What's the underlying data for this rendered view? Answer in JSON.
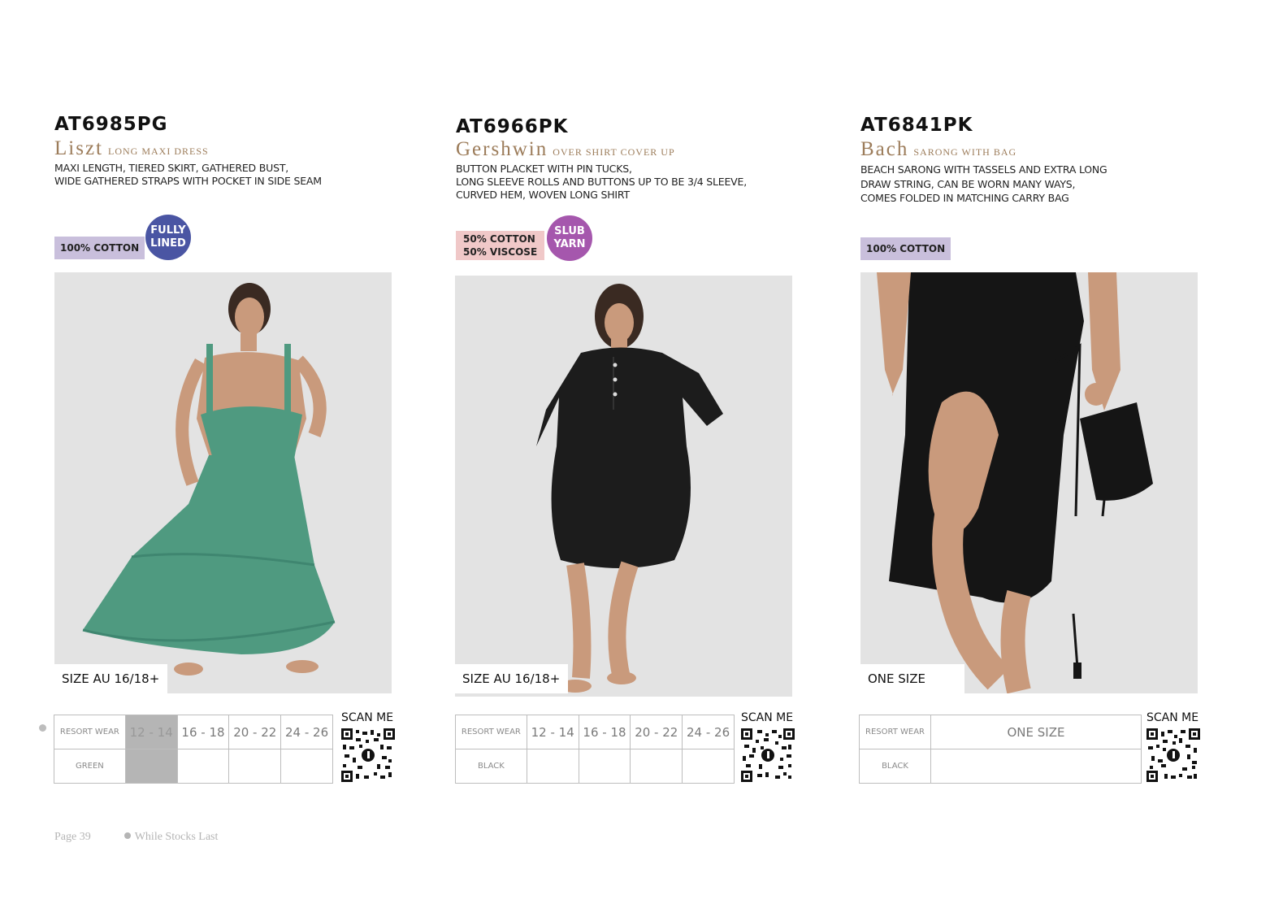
{
  "products": [
    {
      "code": "AT6985PG",
      "name": "Liszt",
      "type": "LONG MAXI DRESS",
      "desc": [
        "MAXI LENGTH, TIERED SKIRT, GATHERED BUST,",
        "WIDE GATHERED STRAPS WITH POCKET IN SIDE SEAM"
      ],
      "fabric": [
        "100% COTTON"
      ],
      "fabric_color": "#c9bfdc",
      "badge": [
        "FULLY",
        "LINED"
      ],
      "badge_color": "#4a55a3",
      "size_label": "SIZE AU 16/18+",
      "table": {
        "row1": "RESORT WEAR",
        "sizes": [
          "12 - 14",
          "16 - 18",
          "20 - 22",
          "24 - 26"
        ],
        "row2": "GREEN"
      },
      "scan": "SCAN ME",
      "garment_color": "#4f9a80"
    },
    {
      "code": "AT6966PK",
      "name": "Gershwin",
      "type": "OVER SHIRT COVER UP",
      "desc": [
        "BUTTON PLACKET WITH PIN TUCKS,",
        "LONG SLEEVE ROLLS AND BUTTONS UP TO BE 3/4 SLEEVE,",
        "CURVED HEM, WOVEN LONG SHIRT"
      ],
      "fabric": [
        "50% COTTON",
        "50% VISCOSE"
      ],
      "fabric_color": "#f0c8c8",
      "badge": [
        "SLUB",
        "YARN"
      ],
      "badge_color": "#a557ad",
      "size_label": "SIZE AU 16/18+",
      "table": {
        "row1": "RESORT WEAR",
        "sizes": [
          "12 - 14",
          "16 - 18",
          "20 - 22",
          "24 - 26"
        ],
        "row2": "BLACK"
      },
      "scan": "SCAN ME",
      "garment_color": "#1c1c1c"
    },
    {
      "code": "AT6841PK",
      "name": "Bach",
      "type": "SARONG WITH BAG",
      "desc": [
        "BEACH SARONG WITH TASSELS AND EXTRA LONG",
        "DRAW STRING, CAN BE WORN MANY WAYS,",
        "COMES FOLDED IN MATCHING CARRY BAG"
      ],
      "fabric": [
        "100% COTTON"
      ],
      "fabric_color": "#c9bfdc",
      "size_label": "ONE SIZE",
      "table": {
        "row1": "RESORT WEAR",
        "size_one": "ONE SIZE",
        "row2": "BLACK"
      },
      "scan": "SCAN ME",
      "garment_color": "#151515"
    }
  ],
  "footer": {
    "page": "Page 39",
    "note": "While Stocks Last"
  }
}
